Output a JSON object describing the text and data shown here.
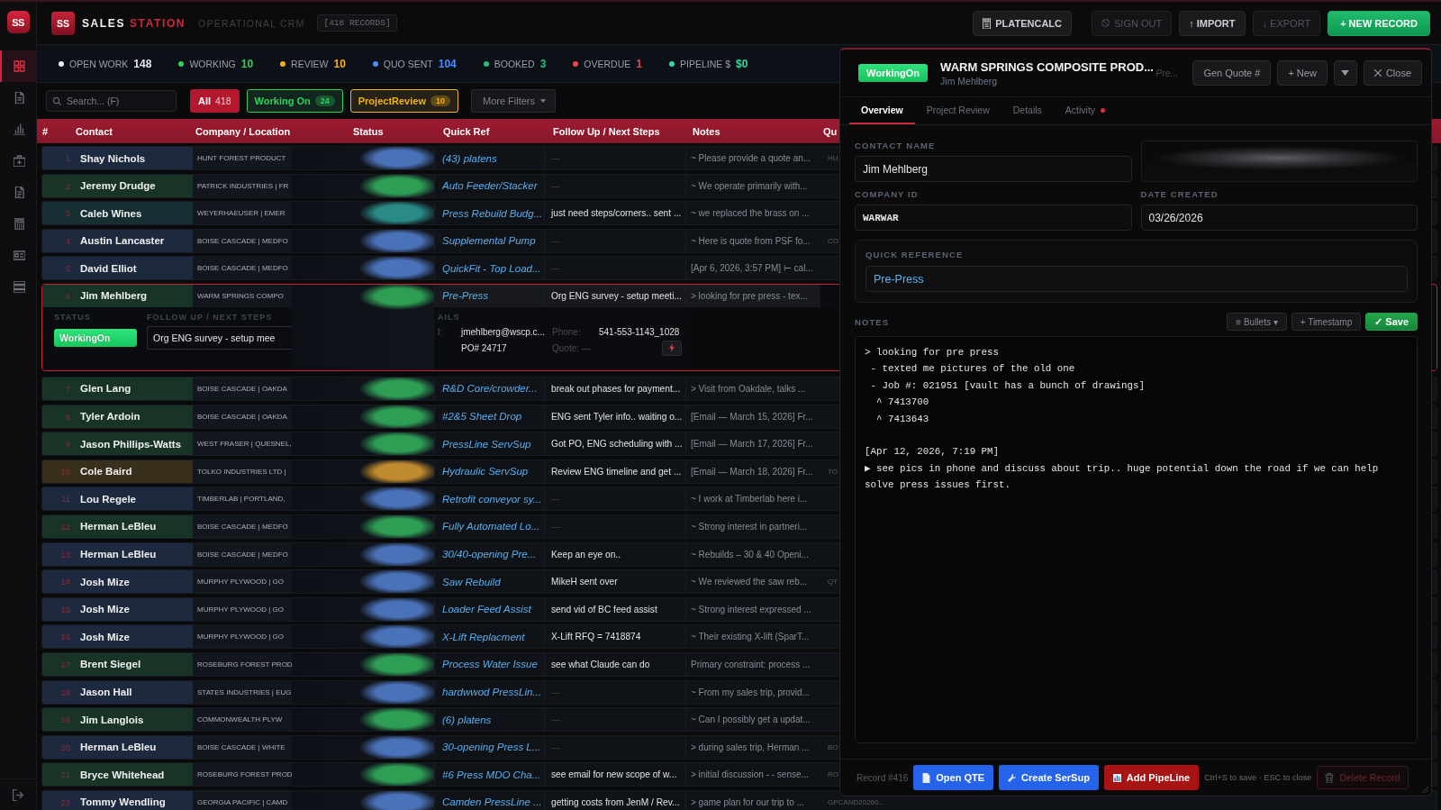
{
  "rail": {
    "logo": "SS",
    "items": [
      {
        "selected": true
      },
      {
        "selected": false
      },
      {
        "selected": false
      },
      {
        "selected": false
      },
      {
        "selected": false
      },
      {
        "selected": false
      },
      {
        "selected": false
      },
      {
        "selected": false
      }
    ]
  },
  "header": {
    "logo": "SS",
    "brand_primary": "SALES",
    "brand_accent": "STATION",
    "subtitle": "OPERATIONAL CRM",
    "record_count": "[418 RECORDS]",
    "actions": [
      {
        "label": "PLATENCALC",
        "kind": "tool",
        "disabled": false
      },
      {
        "label": "SIGN OUT",
        "kind": "signout",
        "disabled": true
      },
      {
        "label": "↑ IMPORT",
        "kind": "plain",
        "disabled": false
      },
      {
        "label": "↓ EXPORT",
        "kind": "plain",
        "disabled": true
      },
      {
        "label": "+ NEW RECORD",
        "kind": "primary",
        "disabled": false
      }
    ]
  },
  "stats": [
    {
      "label": "OPEN WORK",
      "value": "148",
      "color": "#e5e7eb"
    },
    {
      "label": "WORKING",
      "value": "10",
      "color": "#2fd35c"
    },
    {
      "label": "REVIEW",
      "value": "10",
      "color": "#f5b316"
    },
    {
      "label": "QUO SENT",
      "value": "104",
      "color": "#4b8cff"
    },
    {
      "label": "BOOKED",
      "value": "3",
      "color": "#21c07f"
    },
    {
      "label": "OVERDUE",
      "value": "1",
      "color": "#f0444f"
    },
    {
      "label": "PIPELINE $",
      "value": "$0",
      "color": "#3ad6a0"
    }
  ],
  "filters": {
    "search": {
      "placeholder": "Search... (F)"
    },
    "chips": [
      {
        "label": "All",
        "count": "418",
        "selected": true,
        "color": "#b3192e"
      },
      {
        "label": "Working On",
        "count": "24",
        "selected": false,
        "color": "#2fd35c"
      },
      {
        "label": "ProjectReview",
        "count": "10",
        "selected": false,
        "color": "#f5b316"
      }
    ],
    "more": "More Filters"
  },
  "table": {
    "columns": [
      "#",
      "Contact",
      "Company / Location",
      "Status",
      "Quick Ref",
      "Follow Up / Next Steps",
      "Notes",
      "Qu"
    ],
    "rows": [
      {
        "number": "1",
        "contact": "Shay Nichols",
        "company": "HUNT FOREST PRODUCT",
        "color": "#4a72b8",
        "quick_ref": "(43) platens",
        "follow_up": "—",
        "has_follow_up": false,
        "notes": "~ Please provide a quote an...",
        "column_8": "HU",
        "expanded": false
      },
      {
        "number": "2",
        "contact": "Jeremy Drudge",
        "company": "PATRICK INDUSTRIES | FR",
        "color": "#2f9e55",
        "quick_ref": "Auto Feeder/Stacker",
        "follow_up": "—",
        "has_follow_up": false,
        "notes": "~ We operate primarily with...",
        "expanded": false
      },
      {
        "number": "3",
        "contact": "Caleb Wines",
        "company": "WEYERHAEUSER | EMER",
        "color": "#2a8a86",
        "quick_ref": "Press Rebuild Budg...",
        "follow_up": "just need steps/corners.. sent ...",
        "has_follow_up": true,
        "notes": "~ we replaced the brass on ...",
        "expanded": false
      },
      {
        "number": "4",
        "contact": "Austin Lancaster",
        "company": "BOISE CASCADE | MEDFO",
        "color": "#4a72b8",
        "quick_ref": "Supplemental Pump",
        "follow_up": "—",
        "has_follow_up": false,
        "notes": "~ Here is quote from PSF fo...",
        "column_8": "CO",
        "expanded": false
      },
      {
        "number": "5",
        "contact": "David Elliot",
        "company": "BOISE CASCADE | MEDFO",
        "color": "#4a72b8",
        "quick_ref": "QuickFit - Top Load...",
        "follow_up": "—",
        "has_follow_up": false,
        "notes": "[Apr 6, 2026, 3:57 PM] ⊢ cal...",
        "expanded": false
      },
      {
        "number": "6",
        "contact": "Jim Mehlberg",
        "company": "WARM SPRINGS COMPO",
        "color": "#2f9e55",
        "quick_ref": "Pre-Press",
        "follow_up": "Org ENG survey - setup meeti...",
        "has_follow_up": true,
        "notes": "> looking for pre press - tex...",
        "expanded": true,
        "detail": {
          "status_label": "STATUS",
          "status": "WorkingOn",
          "follow_up_label": "FOLLOW UP / NEXT STEPS",
          "follow_up_value": "Org ENG survey - setup mee",
          "details_label": "AILS",
          "email_label": "l:",
          "email": "jmehlberg@wscp.c...",
          "po": "PO# 24717",
          "phone_label": "Phone:",
          "phone": "541-553-1143_1028",
          "quote": "Quote: —"
        }
      },
      {
        "number": "7",
        "contact": "Glen Lang",
        "company": "BOISE CASCADE | OAKDA",
        "color": "#2f9e55",
        "quick_ref": "R&D Core/crowder...",
        "follow_up": "break out phases for payment...",
        "has_follow_up": true,
        "notes": "> Visit from Oakdale, talks ...",
        "expanded": false
      },
      {
        "number": "8",
        "contact": "Tyler Ardoin",
        "company": "BOISE CASCADE | OAKDA",
        "color": "#2f9e55",
        "quick_ref": "#2&5 Sheet Drop",
        "follow_up": "ENG sent Tyler info.. waiting o...",
        "has_follow_up": true,
        "notes": "[Email — March 15, 2026] Fr...",
        "expanded": false
      },
      {
        "number": "9",
        "contact": "Jason Phillips-Watts",
        "company": "WEST FRASER | QUESNEL,",
        "color": "#2f9e55",
        "quick_ref": "PressLine ServSup",
        "follow_up": "Got PO, ENG scheduling with ...",
        "has_follow_up": true,
        "notes": "[Email — March 17, 2026] Fr...",
        "expanded": false
      },
      {
        "number": "10",
        "contact": "Cole Baird",
        "company": "TOLKO INDUSTRIES LTD |",
        "color": "#c08a2e",
        "quick_ref": "Hydraulic ServSup",
        "follow_up": "Review ENG timeline and get ...",
        "has_follow_up": true,
        "notes": "[Email — March 18, 2026] Fr...",
        "column_8": "TO",
        "expanded": false
      },
      {
        "number": "11",
        "contact": "Lou Regele",
        "company": "TIMBERLAB | PORTLAND,",
        "color": "#4a72b8",
        "quick_ref": "Retrofit conveyor sy...",
        "follow_up": "—",
        "has_follow_up": false,
        "notes": "~ I work at Timberlab here i...",
        "expanded": false
      },
      {
        "number": "12",
        "contact": "Herman LeBleu",
        "company": "BOISE CASCADE | MEDFO",
        "color": "#2f9e55",
        "quick_ref": "Fully Automated Lo...",
        "follow_up": "—",
        "has_follow_up": false,
        "notes": "~ Strong interest in partneri...",
        "expanded": false
      },
      {
        "number": "13",
        "contact": "Herman LeBleu",
        "company": "BOISE CASCADE | MEDFO",
        "color": "#4a72b8",
        "quick_ref": "30/40-opening Pre...",
        "follow_up": "Keep an eye on..",
        "has_follow_up": true,
        "notes": "~ Rebuilds – 30 & 40 Openi...",
        "expanded": false
      },
      {
        "number": "14",
        "contact": "Josh Mize",
        "company": "MURPHY PLYWOOD | GO",
        "color": "#4a72b8",
        "quick_ref": "Saw Rebuild",
        "follow_up": "MikeH sent over",
        "has_follow_up": true,
        "notes": "~ We reviewed the saw reb...",
        "column_8": "QT",
        "expanded": false
      },
      {
        "number": "15",
        "contact": "Josh Mize",
        "company": "MURPHY PLYWOOD | GO",
        "color": "#4a72b8",
        "quick_ref": "Loader Feed Assist",
        "follow_up": "send vid of BC feed assist",
        "has_follow_up": true,
        "notes": "~ Strong interest expressed ...",
        "expanded": false
      },
      {
        "number": "16",
        "contact": "Josh Mize",
        "company": "MURPHY PLYWOOD | GO",
        "color": "#4a72b8",
        "quick_ref": "X-Lift Replacment",
        "follow_up": "X-Lift RFQ = 7418874",
        "has_follow_up": true,
        "notes": "~ Their existing X-lift (SparT...",
        "expanded": false
      },
      {
        "number": "17",
        "contact": "Brent Siegel",
        "company": "ROSEBURG FOREST PROD",
        "color": "#2f9e55",
        "quick_ref": "Process Water Issue",
        "follow_up": "see what Claude can do",
        "has_follow_up": true,
        "notes": "Primary constraint: process ...",
        "expanded": false
      },
      {
        "number": "18",
        "contact": "Jason Hall",
        "company": "STATES INDUSTRIES | EUG",
        "color": "#4a72b8",
        "quick_ref": "hardwwod PressLin...",
        "follow_up": "—",
        "has_follow_up": false,
        "notes": "~ From my sales trip, provid...",
        "expanded": false
      },
      {
        "number": "19",
        "contact": "Jim Langlois",
        "company": "COMMONWEALTH PLYW",
        "color": "#2f9e55",
        "quick_ref": "(6) platens",
        "follow_up": "—",
        "has_follow_up": false,
        "notes": "~ Can I possibly get a updat...",
        "expanded": false
      },
      {
        "number": "20",
        "contact": "Herman LeBleu",
        "company": "BOISE CASCADE | WHITE",
        "color": "#4a72b8",
        "quick_ref": "30-opening Press L...",
        "follow_up": "—",
        "has_follow_up": false,
        "notes": "> during sales trip, Herman ...",
        "column_8": "BO",
        "expanded": false
      },
      {
        "number": "21",
        "contact": "Bryce Whitehead",
        "company": "ROSEBURG FOREST PROD",
        "color": "#2f9e55",
        "quick_ref": "#6 Press MDO Cha...",
        "follow_up": "see email for new scope of w...",
        "has_follow_up": true,
        "notes": "> initial discussion - - sense...",
        "column_8": "RO",
        "expanded": false
      },
      {
        "number": "22",
        "contact": "Tommy Wendling",
        "company": "GEORGIA PACIFIC | CAMD",
        "color": "#4a72b8",
        "quick_ref": "Camden PressLine ...",
        "follow_up": "getting costs from JenM / Rev...",
        "has_follow_up": true,
        "notes": "> game plan for our trip to ...",
        "column_8": "GPCAND20260...",
        "expanded": false
      }
    ]
  },
  "panel": {
    "status": "WorkingOn",
    "title": "WARM SPRINGS COMPOSITE PROD...",
    "subtitle": "Jim Mehlberg",
    "quick_ref_hint": "Pre...",
    "actions": [
      {
        "kind": "text",
        "label": "Gen Quote #"
      },
      {
        "kind": "text",
        "label": "+ New"
      },
      {
        "kind": "menu"
      },
      {
        "kind": "close",
        "label": "Close"
      }
    ],
    "tabs": [
      {
        "label": "Overview",
        "selected": true,
        "unread": false
      },
      {
        "label": "Project Review",
        "selected": false,
        "unread": false
      },
      {
        "label": "Details",
        "selected": false,
        "unread": false
      },
      {
        "label": "Activity",
        "selected": false,
        "unread": true
      }
    ],
    "contact_name": {
      "label": "CONTACT NAME",
      "value": "Jim Mehlberg"
    },
    "company_id": {
      "label": "COMPANY ID",
      "value": "WARWAR"
    },
    "date_created": {
      "label": "DATE CREATED",
      "value": "03/26/2026"
    },
    "quick_reference": {
      "label": "QUICK REFERENCE",
      "value": "Pre-Press"
    },
    "notes": {
      "label": "NOTES",
      "tools": [
        {
          "kind": "plain",
          "label": "≡ Bullets ▾"
        },
        {
          "kind": "plain",
          "label": "+ Timestamp"
        },
        {
          "kind": "primary",
          "label": "✓ Save"
        }
      ],
      "value": "> looking for pre press\n - texted me pictures of the old one\n - Job #: 021951 [vault has a bunch of drawings]\n  ^ 7413700\n  ^ 7413643\n\n[Apr 12, 2026, 7:19 PM]\n▶ see pics in phone and discuss about trip.. huge potential down the road if we can help solve press issues first."
    },
    "footer": {
      "record": "Record #416",
      "actions": [
        {
          "label": "Open QTE",
          "color": "#2563eb"
        },
        {
          "label": "Create SerSup",
          "color": "#2563eb"
        },
        {
          "label": "Add PipeLine",
          "color": "#a81414"
        }
      ],
      "hint": "Ctrl+S to save · ESC to close",
      "delete": {
        "label": "Delete Record",
        "disabled": true
      }
    }
  }
}
